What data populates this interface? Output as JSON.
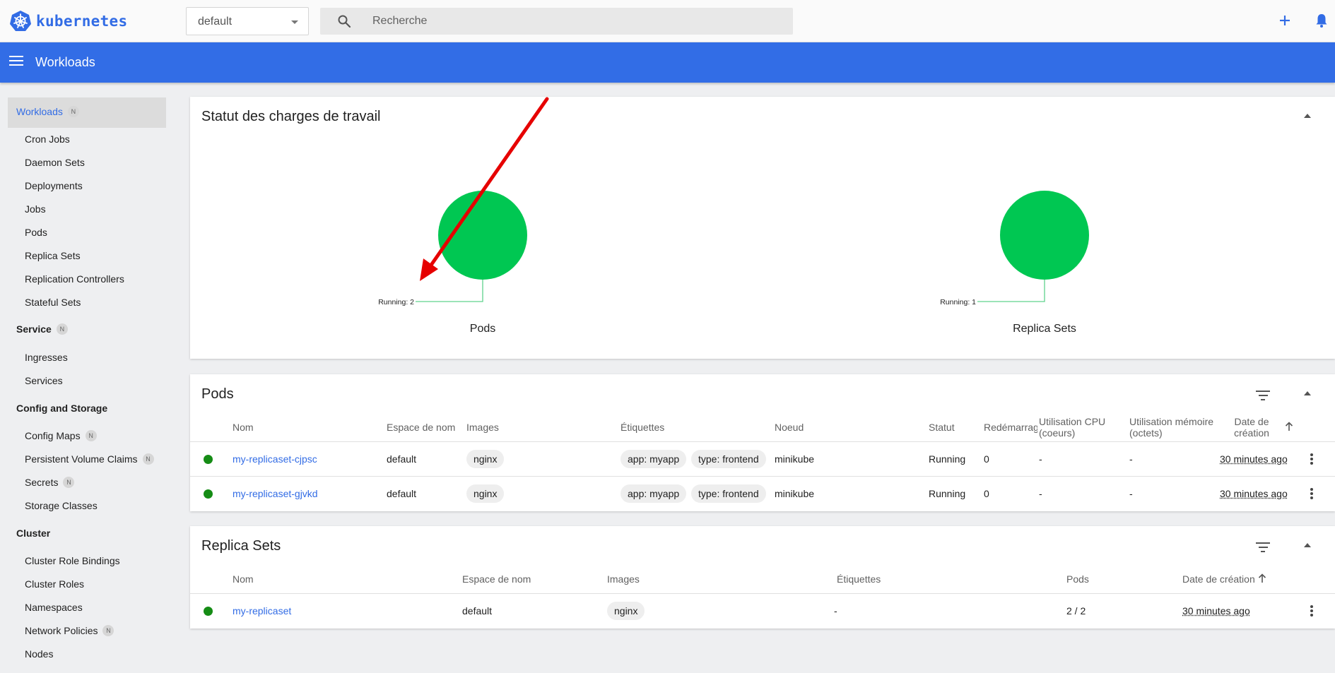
{
  "app": {
    "name": "kubernetes"
  },
  "namespace": {
    "selected": "default"
  },
  "search": {
    "placeholder": "Recherche"
  },
  "header": {
    "title": "Workloads"
  },
  "sidebar": {
    "workloads": {
      "label": "Workloads",
      "badge": "N"
    },
    "workload_items": [
      "Cron Jobs",
      "Daemon Sets",
      "Deployments",
      "Jobs",
      "Pods",
      "Replica Sets",
      "Replication Controllers",
      "Stateful Sets"
    ],
    "service": {
      "label": "Service",
      "badge": "N"
    },
    "service_items": [
      "Ingresses",
      "Services"
    ],
    "config": {
      "label": "Config and Storage"
    },
    "config_items": [
      {
        "label": "Config Maps",
        "badge": "N"
      },
      {
        "label": "Persistent Volume Claims",
        "badge": "N"
      },
      {
        "label": "Secrets",
        "badge": "N"
      },
      {
        "label": "Storage Classes",
        "badge": ""
      }
    ],
    "cluster": {
      "label": "Cluster"
    },
    "cluster_items": [
      {
        "label": "Cluster Role Bindings",
        "badge": ""
      },
      {
        "label": "Cluster Roles",
        "badge": ""
      },
      {
        "label": "Namespaces",
        "badge": ""
      },
      {
        "label": "Network Policies",
        "badge": "N"
      },
      {
        "label": "Nodes",
        "badge": ""
      }
    ]
  },
  "status_card": {
    "title": "Statut des charges de travail",
    "charts": [
      {
        "label": "Pods",
        "legend": "Running: 2",
        "running": 2,
        "color": "#00c752"
      },
      {
        "label": "Replica Sets",
        "legend": "Running: 1",
        "running": 1,
        "color": "#00c752"
      }
    ]
  },
  "pods_card": {
    "title": "Pods",
    "headers": {
      "name": "Nom",
      "namespace": "Espace de nom",
      "images": "Images",
      "labels": "Étiquettes",
      "node": "Noeud",
      "status": "Statut",
      "restarts": "Redémarrag",
      "cpu": "Utilisation CPU (coeurs)",
      "mem": "Utilisation mémoire (octets)",
      "created": "Date de création"
    },
    "rows": [
      {
        "name": "my-replicaset-cjpsc",
        "namespace": "default",
        "image": "nginx",
        "label1": "app: myapp",
        "label2": "type: frontend",
        "node": "minikube",
        "status": "Running",
        "restarts": "0",
        "cpu": "-",
        "mem": "-",
        "created": "30 minutes ago"
      },
      {
        "name": "my-replicaset-gjvkd",
        "namespace": "default",
        "image": "nginx",
        "label1": "app: myapp",
        "label2": "type: frontend",
        "node": "minikube",
        "status": "Running",
        "restarts": "0",
        "cpu": "-",
        "mem": "-",
        "created": "30 minutes ago"
      }
    ]
  },
  "replicasets_card": {
    "title": "Replica Sets",
    "headers": {
      "name": "Nom",
      "namespace": "Espace de nom",
      "images": "Images",
      "labels": "Étiquettes",
      "pods": "Pods",
      "created": "Date de création"
    },
    "rows": [
      {
        "name": "my-replicaset",
        "namespace": "default",
        "image": "nginx",
        "labels": "-",
        "pods": "2 / 2",
        "created": "30 minutes ago"
      }
    ]
  },
  "colors": {
    "accent": "#326ce5",
    "running": "#00c752",
    "annotation_arrow": "#e60000"
  }
}
